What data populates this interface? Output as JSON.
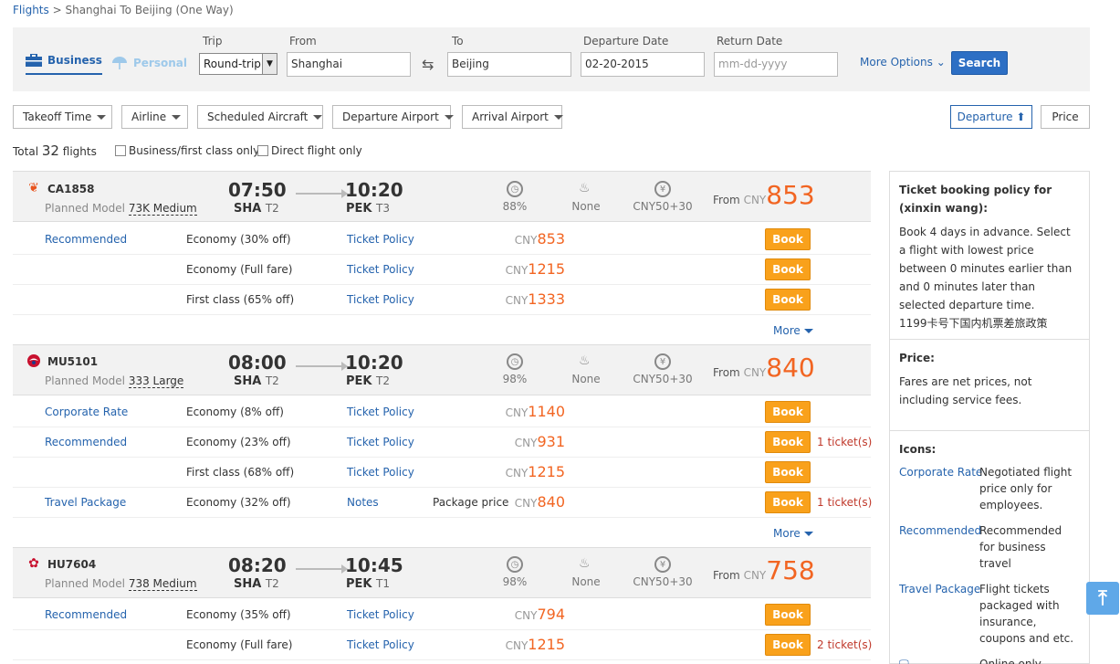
{
  "breadcrumb": {
    "root": "Flights",
    "sep": ">",
    "current": "Shanghai To Beijing (One Way)"
  },
  "search": {
    "tab_business": "Business",
    "tab_personal": "Personal",
    "trip_label": "Trip",
    "trip_value": "Round-trip",
    "from_label": "From",
    "from_value": "Shanghai",
    "to_label": "To",
    "to_value": "Beijing",
    "dep_label": "Departure Date",
    "dep_value": "02-20-2015",
    "ret_label": "Return Date",
    "ret_placeholder": "mm-dd-yyyy",
    "more_options": "More Options",
    "search_button": "Search"
  },
  "filters": [
    "Takeoff Time",
    "Airline",
    "Scheduled Aircraft",
    "Departure Airport",
    "Arrival Airport"
  ],
  "sort": {
    "departure": "Departure",
    "price": "Price"
  },
  "summary": {
    "total_prefix": "Total",
    "total_count": "32",
    "total_suffix": "flights",
    "biz_only": "Business/first class only",
    "direct_only": "Direct flight only"
  },
  "labels": {
    "planned_model": "Planned Model",
    "from": "From",
    "cny": "CNY",
    "book": "Book",
    "more": "More"
  },
  "flights": [
    {
      "no": "CA1858",
      "model": "73K Medium",
      "dep_time": "07:50",
      "dep_ap": "SHA",
      "dep_term": "T2",
      "arr_time": "10:20",
      "arr_ap": "PEK",
      "arr_term": "T3",
      "ontime": "88%",
      "meal": "None",
      "tax": "CNY50+30",
      "from_price": "853",
      "fares": [
        {
          "label": "Recommended",
          "cls": "Economy  (30% off)",
          "policy": "Ticket Policy",
          "pkg": "",
          "price": "853",
          "tickets": ""
        },
        {
          "label": "",
          "cls": "Economy   (Full fare)",
          "policy": "Ticket Policy",
          "pkg": "",
          "price": "1215",
          "tickets": ""
        },
        {
          "label": "",
          "cls": "First class  (65% off)",
          "policy": "Ticket Policy",
          "pkg": "",
          "price": "1333",
          "tickets": ""
        }
      ]
    },
    {
      "no": "MU5101",
      "model": "333 Large",
      "dep_time": "08:00",
      "dep_ap": "SHA",
      "dep_term": "T2",
      "arr_time": "10:20",
      "arr_ap": "PEK",
      "arr_term": "T2",
      "ontime": "98%",
      "meal": "None",
      "tax": "CNY50+30",
      "from_price": "840",
      "fares": [
        {
          "label": "Corporate Rate",
          "cls": "Economy   (8% off)",
          "policy": "Ticket Policy",
          "pkg": "",
          "price": "1140",
          "tickets": ""
        },
        {
          "label": "Recommended",
          "cls": "Economy  (23% off)",
          "policy": "Ticket Policy",
          "pkg": "",
          "price": "931",
          "tickets": "1 ticket(s)"
        },
        {
          "label": "",
          "cls": "First class  (68% off)",
          "policy": "Ticket Policy",
          "pkg": "",
          "price": "1215",
          "tickets": ""
        },
        {
          "label": "Travel Package",
          "cls": "Economy  (32% off)",
          "policy": "Notes",
          "pkg": "Package price",
          "price": "840",
          "tickets": "1 ticket(s)"
        }
      ]
    },
    {
      "no": "HU7604",
      "model": "738 Medium",
      "dep_time": "08:20",
      "dep_ap": "SHA",
      "dep_term": "T2",
      "arr_time": "10:45",
      "arr_ap": "PEK",
      "arr_term": "T1",
      "ontime": "98%",
      "meal": "None",
      "tax": "CNY50+30",
      "from_price": "758",
      "fares": [
        {
          "label": "Recommended",
          "cls": "Economy  (35% off)",
          "policy": "Ticket Policy",
          "pkg": "",
          "price": "794",
          "tickets": ""
        },
        {
          "label": "",
          "cls": "Economy   (Full fare)",
          "policy": "Ticket Policy",
          "pkg": "",
          "price": "1215",
          "tickets": "2 ticket(s)"
        }
      ]
    }
  ],
  "sidebar": {
    "policy_title": "Ticket booking policy for (xinxin wang):",
    "policy_text": "Book 4 days in advance. Select a flight with lowest price between 0 minutes earlier than and 0 minutes later than selected departure time.",
    "policy_cn": "1199卡号下国内机票差旅政策",
    "price_title": "Price:",
    "price_text": "Fares are net prices, not including service fees.",
    "icons_title": "Icons:",
    "icons": [
      {
        "k": "Corporate Rate",
        "v": "Negotiated flight price only for employees."
      },
      {
        "k": "Recommended",
        "v": "Recommended for business travel"
      },
      {
        "k": "Travel Package",
        "v": "Flight tickets packaged with insurance, coupons and etc."
      }
    ],
    "online_only": "Online only"
  }
}
